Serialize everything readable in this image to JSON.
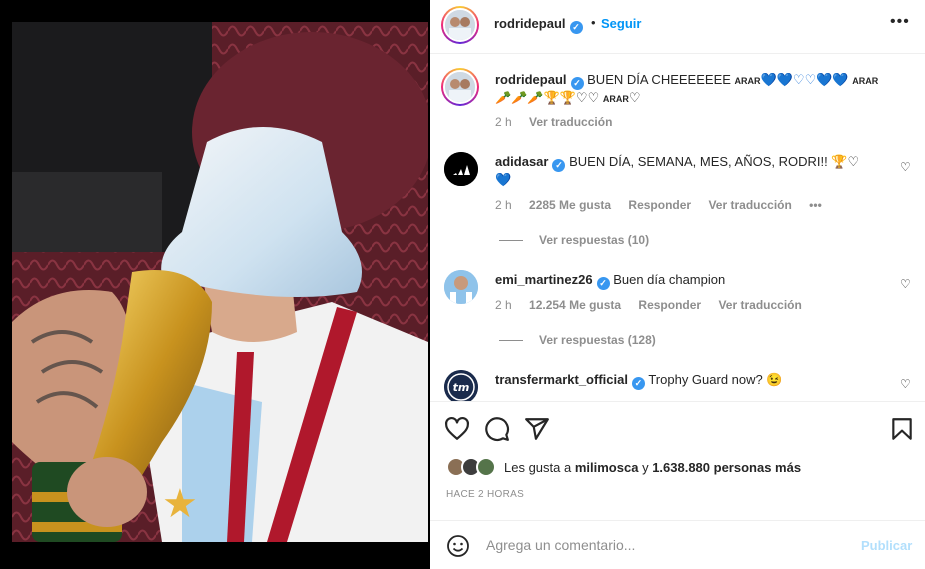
{
  "post": {
    "author": "rodridepaul",
    "follow_label": "Seguir",
    "dot": "•"
  },
  "caption": {
    "username": "rodridepaul",
    "text": "BUEN DÍA CHEEEEEEE",
    "word_arar": "ARAR",
    "hearts_line1": "💙💙♡♡💙💙",
    "emojis_line2": "🥕🥕🥕🏆🏆♡♡",
    "heart_end": "♡",
    "time": "2 h",
    "translate": "Ver traducción"
  },
  "comments": [
    {
      "username": "adidasar",
      "text": "BUEN DÍA, SEMANA, MES, AÑOS, RODRI!! 🏆♡",
      "text_line2": "💙",
      "time": "2 h",
      "likes": "2285 Me gusta",
      "reply": "Responder",
      "translate": "Ver traducción",
      "more": "•••",
      "view_replies": "Ver respuestas (10)"
    },
    {
      "username": "emi_martinez26",
      "text": "Buen día champion",
      "time": "2 h",
      "likes": "12.254 Me gusta",
      "reply": "Responder",
      "translate": "Ver traducción",
      "view_replies": "Ver respuestas (128)"
    },
    {
      "username": "transfermarkt_official",
      "text": "Trophy Guard now? 😉"
    }
  ],
  "likes": {
    "prefix": "Les gusta a",
    "user": "milimosca",
    "conj": "y",
    "count": "1.638.880 personas más"
  },
  "timestamp": "HACE 2 HORAS",
  "comment_box": {
    "placeholder": "Agrega un comentario...",
    "publish": "Publicar"
  },
  "colors": {
    "accent": "#0095f6",
    "verified": "#3897f0",
    "publish_disabled": "#b2dffc"
  },
  "icons": [
    "heart-icon",
    "comment-icon",
    "share-icon",
    "bookmark-icon",
    "emoji-icon",
    "more-icon",
    "verified-icon"
  ]
}
